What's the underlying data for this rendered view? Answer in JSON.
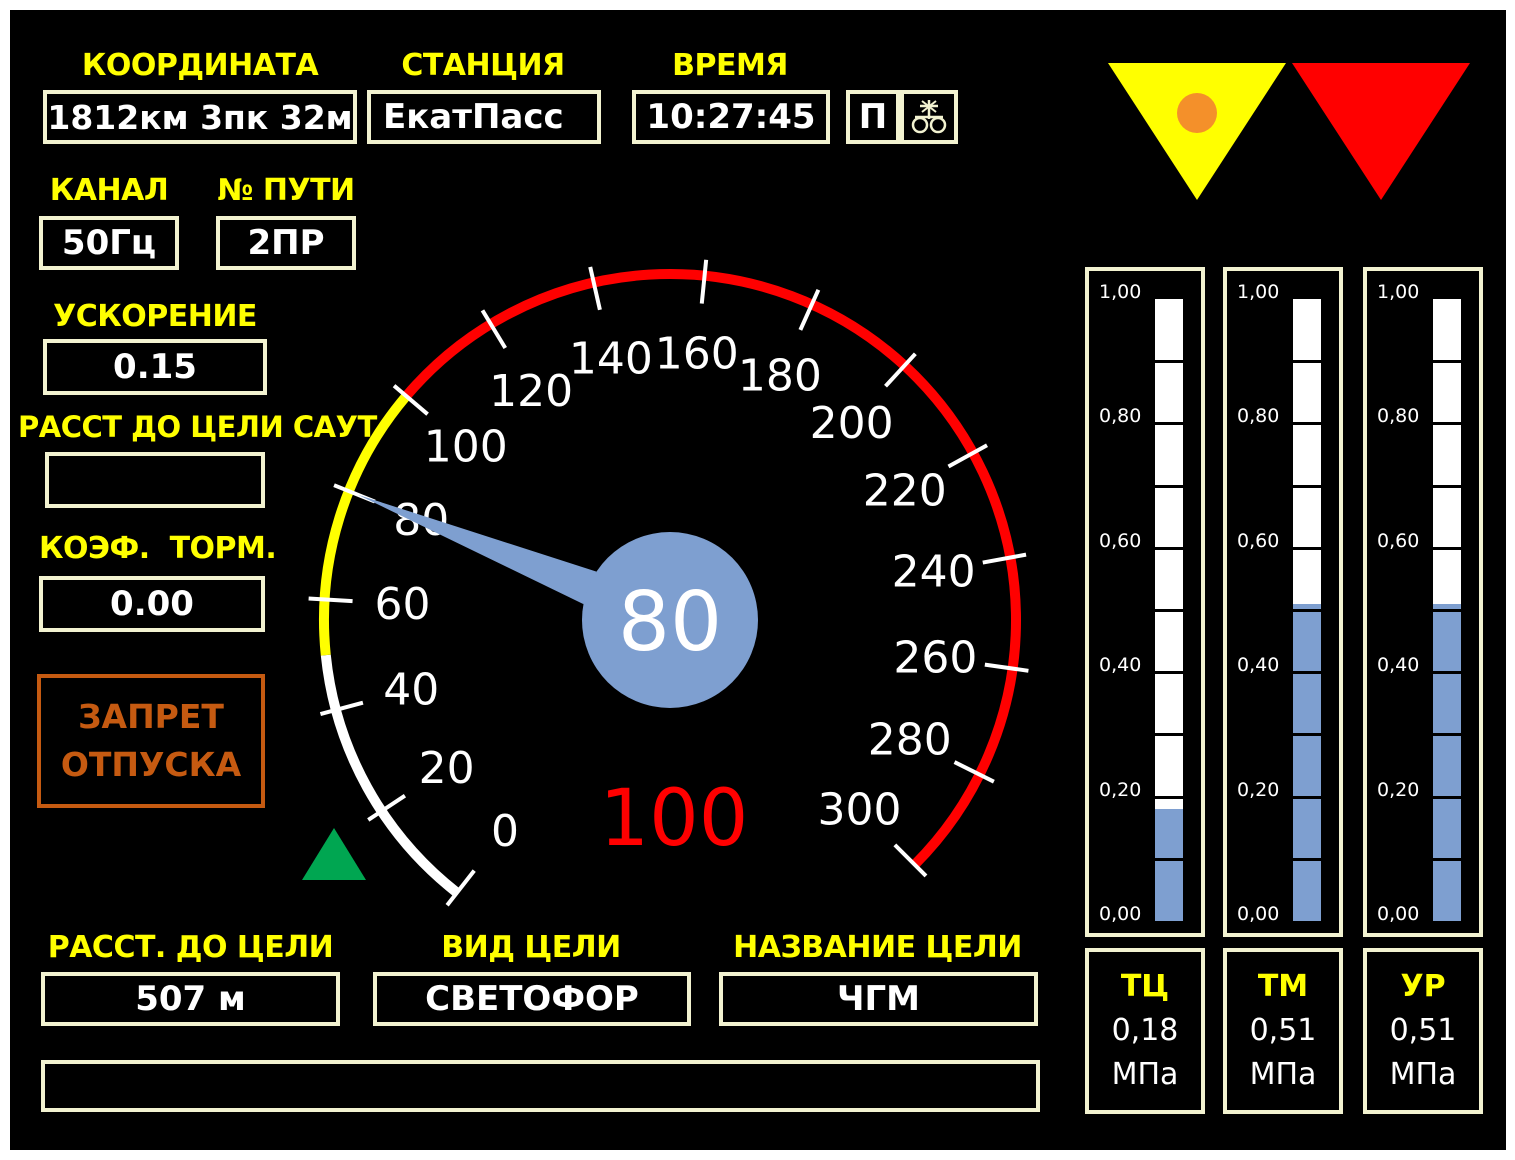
{
  "header": {
    "coordinate": {
      "label": "КООРДИНАТА",
      "value": "1812км 3пк 32м"
    },
    "station": {
      "label": "СТАНЦИЯ",
      "value": "ЕкатПасс"
    },
    "time": {
      "label": "ВРЕМЯ",
      "value": "10:27:45"
    },
    "mode_letter": "П",
    "mode_icon": "train-wheels-icon"
  },
  "channel": {
    "label": "КАНАЛ",
    "value": "50Гц"
  },
  "track": {
    "label": "№ ПУТИ",
    "value": "2ПР"
  },
  "acceleration": {
    "label": "УСКОРЕНИЕ",
    "value": "0.15"
  },
  "saut_distance": {
    "label": "РАССТ ДО ЦЕЛИ САУТ",
    "value": ""
  },
  "brake_coef": {
    "label": "КОЭФ.  ТОРМ.",
    "value": "0.00"
  },
  "release_ban": {
    "line1": "ЗАПРЕТ",
    "line2": "ОТПУСКА",
    "color": "#c55a11"
  },
  "speedometer": {
    "min": 0,
    "max": 300,
    "tick_labels": [
      "0",
      "20",
      "40",
      "60",
      "80",
      "100",
      "120",
      "140",
      "160",
      "180",
      "200",
      "220",
      "240",
      "260",
      "280",
      "300"
    ],
    "current_speed": 80,
    "current_speed_text": "80",
    "limit_speed": 100,
    "limit_speed_text": "100",
    "zones": [
      {
        "from": 0,
        "to": 50,
        "color": "#ffffff"
      },
      {
        "from": 50,
        "to": 100,
        "color": "#ffff00"
      },
      {
        "from": 100,
        "to": 300,
        "color": "#ff0000"
      }
    ],
    "needle_color": "#7e9fd0",
    "limit_color": "#ff0000"
  },
  "indicator_green": {
    "icon": "green-triangle-icon",
    "color": "#00a651"
  },
  "signals": [
    {
      "icon": "yellow-signal-triangle-icon",
      "color": "#ffff00",
      "dot_color": "#f4902a"
    },
    {
      "icon": "red-signal-triangle-icon",
      "color": "#ff0000"
    }
  ],
  "target": {
    "distance": {
      "label": "РАССТ. ДО ЦЕЛИ",
      "value": "507 м"
    },
    "type": {
      "label": "ВИД ЦЕЛИ",
      "value": "СВЕТОФОР"
    },
    "name": {
      "label": "НАЗВАНИЕ ЦЕЛИ",
      "value": "ЧГМ"
    }
  },
  "message_bar": {
    "value": ""
  },
  "pressure_gauges": {
    "scale_labels": [
      "1,00",
      "0,80",
      "0,60",
      "0,40",
      "0,20",
      "0,00"
    ],
    "max": 1.0,
    "fill_color": "#7e9fd0",
    "gauges": [
      {
        "name": "ТЦ",
        "value": 0.18,
        "value_text": "0,18",
        "unit": "МПа"
      },
      {
        "name": "ТМ",
        "value": 0.51,
        "value_text": "0,51",
        "unit": "МПа"
      },
      {
        "name": "УР",
        "value": 0.51,
        "value_text": "0,51",
        "unit": "МПа"
      }
    ]
  }
}
